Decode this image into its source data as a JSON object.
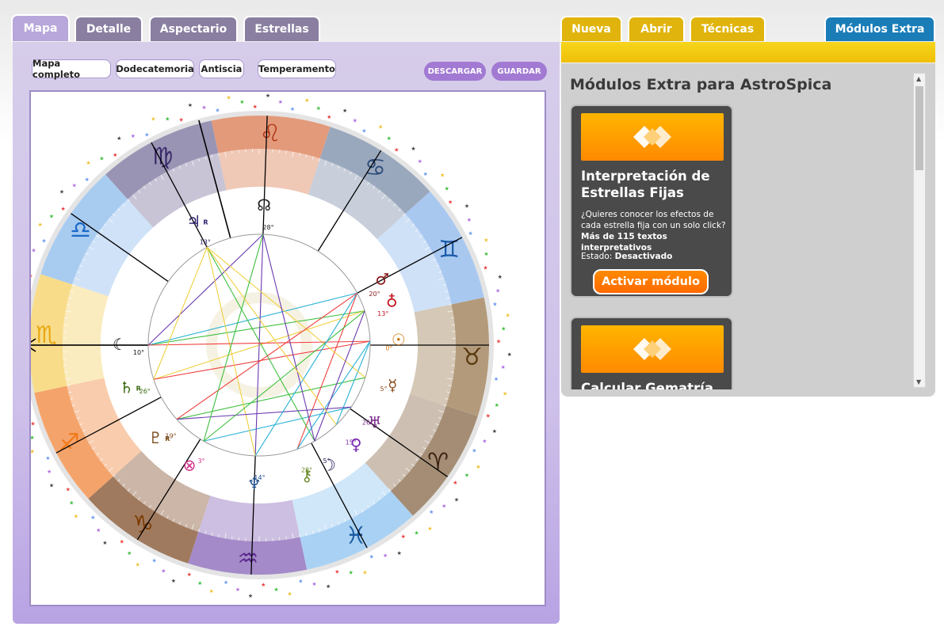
{
  "tabs_left": [
    {
      "label": "Mapa",
      "active": true
    },
    {
      "label": "Detalle",
      "active": false
    },
    {
      "label": "Aspectario",
      "active": false
    },
    {
      "label": "Estrellas",
      "active": false
    }
  ],
  "tabs_right": [
    {
      "label": "Nueva"
    },
    {
      "label": "Abrir"
    },
    {
      "label": "Técnicas"
    },
    {
      "label": "Módulos Extra",
      "active": true
    }
  ],
  "chart_options": [
    "Mapa completo",
    "Dodecatemoria",
    "Antiscia",
    "Temperamento"
  ],
  "actions": {
    "download": "DESCARGAR",
    "save": "GUARDAR"
  },
  "wheel": {
    "signs": [
      {
        "name": "sagittarius",
        "glyph": "♐",
        "color": "#f4a36a",
        "glyph_color": "#f07a1a"
      },
      {
        "name": "capricorn",
        "glyph": "♑",
        "color": "#a07a5e",
        "glyph_color": "#7a3a00"
      },
      {
        "name": "aquarius",
        "glyph": "♒",
        "color": "#a48ac8",
        "glyph_color": "#5b2a8e"
      },
      {
        "name": "pisces",
        "glyph": "♓",
        "color": "#a9d1f4",
        "glyph_color": "#1a5aa0"
      },
      {
        "name": "aries",
        "glyph": "♈",
        "color": "#a48d74",
        "glyph_color": "#3b2214"
      },
      {
        "name": "taurus",
        "glyph": "♉",
        "color": "#b39a7a",
        "glyph_color": "#5a3a10"
      },
      {
        "name": "gemini",
        "glyph": "♊",
        "color": "#a8c8f0",
        "glyph_color": "#1a5aa8"
      },
      {
        "name": "cancer",
        "glyph": "♋",
        "color": "#9aa8bd",
        "glyph_color": "#2a4a78"
      },
      {
        "name": "leo",
        "glyph": "♌",
        "color": "#e39a7a",
        "glyph_color": "#b0381a"
      },
      {
        "name": "virgo",
        "glyph": "♍",
        "color": "#9a94b4",
        "glyph_color": "#3a2a6a"
      },
      {
        "name": "libra",
        "glyph": "♎",
        "color": "#a8cbf0",
        "glyph_color": "#1a6ac8"
      },
      {
        "name": "scorpio",
        "glyph": "♏",
        "color": "#f8dc8a",
        "glyph_color": "#e8a810"
      }
    ],
    "planets": [
      {
        "name": "moon-black",
        "glyph": "☾",
        "degree": "10°",
        "color": "#111111"
      },
      {
        "name": "saturn",
        "glyph": "♄",
        "retro": "R",
        "degree": "26°",
        "color": "#3a6a10"
      },
      {
        "name": "pluto",
        "glyph": "♇",
        "retro": "R",
        "degree": "19°",
        "color": "#7a4a1a"
      },
      {
        "name": "fortune",
        "glyph": "⊗",
        "degree": "3°",
        "color": "#d0308a"
      },
      {
        "name": "neptune",
        "glyph": "♆",
        "degree": "14°",
        "color": "#1a4a8a"
      },
      {
        "name": "chiron",
        "glyph": "⚷",
        "degree": "28°",
        "color": "#6a8a2a"
      },
      {
        "name": "moon",
        "glyph": "☽",
        "degree": "5°",
        "color": "#2a1a5a"
      },
      {
        "name": "venus",
        "glyph": "♀",
        "degree": "15°",
        "color": "#7a2ab0"
      },
      {
        "name": "uranus",
        "glyph": "♅",
        "degree": "26°",
        "color": "#7a2a8a"
      },
      {
        "name": "mercury",
        "glyph": "☿",
        "degree": "5°",
        "color": "#8a4a1a"
      },
      {
        "name": "sun",
        "glyph": "☉",
        "degree": "0°",
        "color": "#d07a10"
      },
      {
        "name": "earth",
        "glyph": "♁",
        "degree": "13°",
        "color": "#c0101a"
      },
      {
        "name": "mars",
        "glyph": "♂",
        "degree": "20°",
        "color": "#8a1a1a"
      },
      {
        "name": "node",
        "glyph": "☊",
        "degree": "28°",
        "color": "#222222"
      },
      {
        "name": "jupiter",
        "glyph": "♃",
        "retro": "R",
        "degree": "13°",
        "color": "#2a1a6a"
      }
    ],
    "aspect_colors": [
      "#3fbf3f",
      "#2ab1d6",
      "#6a3ab0",
      "#f0d040",
      "#ef4040"
    ]
  },
  "modules": {
    "title": "Módulos Extra para AstroSpica",
    "cards": [
      {
        "title": "Interpretación de Estrellas Fijas",
        "desc_1": "¿Quieres conocer los efectos de cada estrella fija con un solo click?",
        "desc_2": "Más de 115 textos interpretativos",
        "status_label": "Estado:",
        "status_value": "Desactivado",
        "button": "Activar módulo"
      },
      {
        "title": "Calcular Gematría"
      }
    ]
  }
}
